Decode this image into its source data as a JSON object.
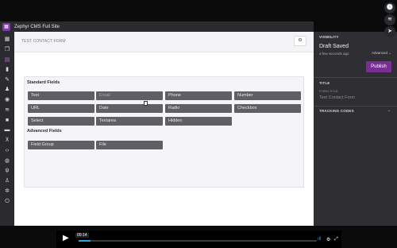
{
  "app": {
    "title": "Zephyr CMS Full Site",
    "logo_glyph": "▦"
  },
  "rail_icons": [
    {
      "name": "dashboard-icon",
      "glyph": "▦"
    },
    {
      "name": "pages-icon",
      "glyph": "❒"
    },
    {
      "name": "forms-icon",
      "glyph": "▤"
    },
    {
      "name": "lock-icon",
      "glyph": "▮"
    },
    {
      "name": "edit-icon",
      "glyph": "✎"
    },
    {
      "name": "user-icon",
      "glyph": "♟"
    },
    {
      "name": "eye-icon",
      "glyph": "◉"
    },
    {
      "name": "signal-icon",
      "glyph": "≋"
    },
    {
      "name": "video-icon",
      "glyph": "■"
    },
    {
      "name": "folder-icon",
      "glyph": "▬"
    },
    {
      "name": "sitemap-icon",
      "glyph": "⊼"
    },
    {
      "name": "code-icon",
      "glyph": "‹›"
    },
    {
      "name": "globe-icon",
      "glyph": "◍"
    },
    {
      "name": "utensils-icon",
      "glyph": "ψ"
    },
    {
      "name": "user-lock-icon",
      "glyph": "♙"
    },
    {
      "name": "settings-icon",
      "glyph": "✲"
    },
    {
      "name": "power-icon",
      "glyph": "⏻"
    }
  ],
  "main": {
    "page_title": "TEST CONTACT FORM",
    "gear_glyph": "⚙",
    "standard_label": "Standard Fields",
    "advanced_label": "Advanced Fields",
    "standard_fields": [
      "Text",
      "Email",
      "Phone",
      "Number",
      "URL",
      "Date",
      "Radio",
      "Checkbox",
      "Select",
      "Textarea",
      "Hidden"
    ],
    "advanced_fields": [
      "Field Group",
      "File"
    ]
  },
  "sidebar": {
    "visibility_header": "VISIBILITY",
    "status": "Draft Saved",
    "saved_ago": "a few seconds ago",
    "advanced_link": "Advanced ⌄",
    "publish_label": "Publish",
    "title_header": "TITLE",
    "form_title_label": "FORM TITLE",
    "form_title_value": "Test Contact Form",
    "tracking_header": "TRACKING CODES",
    "chevron_glyph": "⌄"
  },
  "overlay_buttons": [
    "🕓",
    "≋",
    "➤"
  ],
  "video": {
    "time": "00:14",
    "progress": 0.05,
    "play_glyph": "▶",
    "volume_glyph": "ıll",
    "settings_glyph": "⚙",
    "fullscreen_glyph": "⤢"
  },
  "colors": {
    "accent": "#7a2d96",
    "field_bg": "#5f5f66",
    "rail_bg": "#2b2b2f",
    "progress": "#2ea4dc"
  }
}
